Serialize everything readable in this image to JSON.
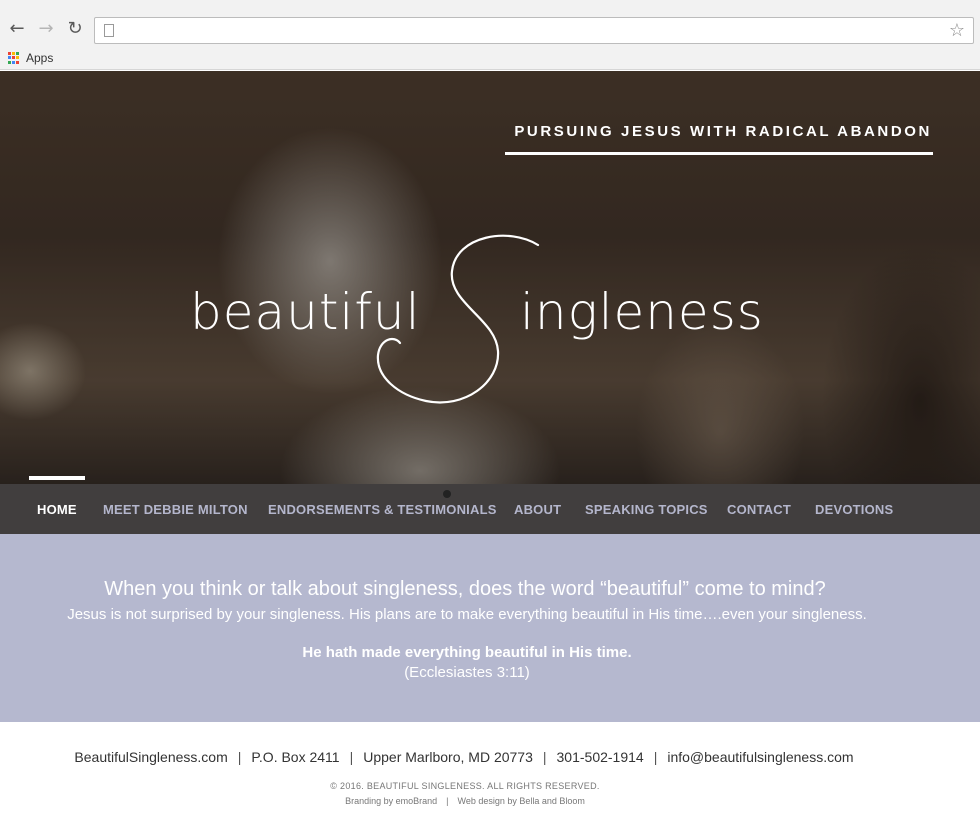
{
  "browser": {
    "back_icon": "arrow-left-icon",
    "forward_icon": "arrow-right-icon",
    "reload_icon": "reload-icon",
    "address_value": "",
    "bookmarks": [
      {
        "label": "Apps"
      }
    ]
  },
  "hero": {
    "tagline": "PURSUING JESUS WITH RADICAL ABANDON",
    "logo_left": "beautiful",
    "logo_right": "ingleness"
  },
  "nav": {
    "items": [
      {
        "label": "HOME",
        "active": true
      },
      {
        "label": "MEET DEBBIE MILTON"
      },
      {
        "label": "ENDORSEMENTS & TESTIMONIALS"
      },
      {
        "label": "ABOUT"
      },
      {
        "label": "SPEAKING TOPICS"
      },
      {
        "label": "CONTACT"
      },
      {
        "label": "DEVOTIONS"
      }
    ]
  },
  "band": {
    "question": "When you think or talk about singleness, does the word “beautiful” come to mind?",
    "subtext": "Jesus is not surprised by your singleness.  His plans are to make everything beautiful in His time….even your singleness.",
    "verse": "He hath made everything beautiful in His time.",
    "reference": "(Ecclesiastes 3:11)"
  },
  "footer": {
    "site": "BeautifulSingleness.com",
    "po_box": "P.O. Box 2411",
    "city": "Upper Marlboro, MD 20773",
    "phone": "301-502-1914",
    "email": "info@beautifulsingleness.com",
    "separator": "|",
    "copyright": "© 2016. BEAUTIFUL SINGLENESS. ALL RIGHTS RESERVED.",
    "branding": "Branding by emoBrand",
    "webdesign": "Web design by Bella and Bloom"
  },
  "colors": {
    "band": "#b5b8cf",
    "nav_bg": "#373434",
    "nav_text": "#b4b6cc"
  }
}
